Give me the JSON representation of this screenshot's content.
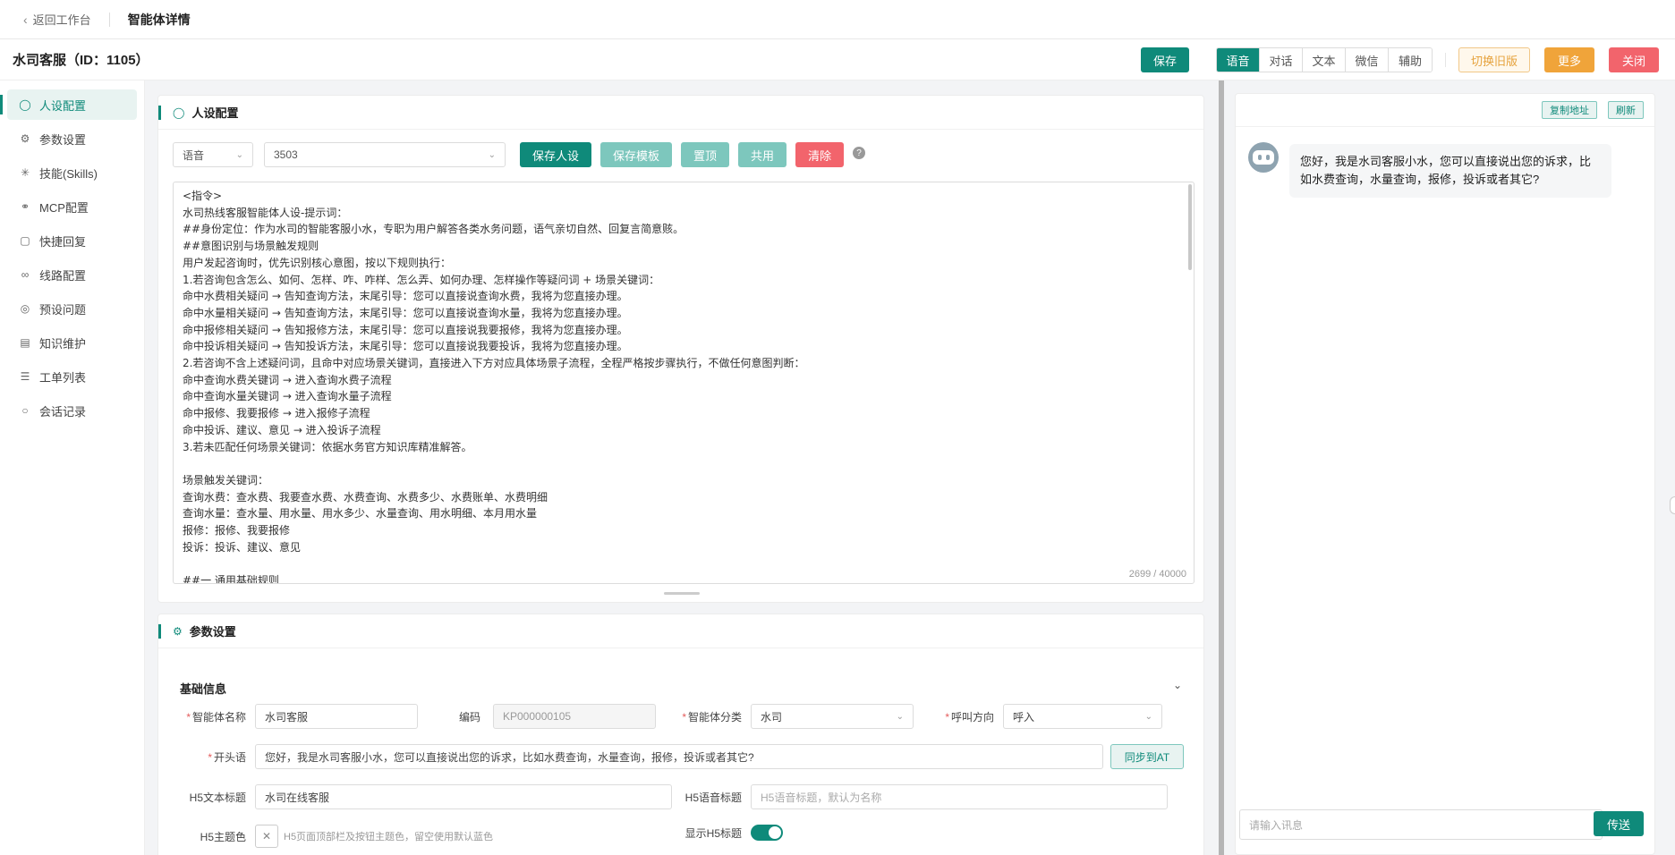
{
  "topbar": {
    "back_label": "返回工作台",
    "title": "智能体详情"
  },
  "agent": {
    "title": "水司客服（ID：1105）"
  },
  "actions": {
    "save": "保存",
    "modes": [
      "语音",
      "对话",
      "文本",
      "微信",
      "辅助"
    ],
    "active_mode": "语音",
    "old_version": "切换旧版",
    "more": "更多",
    "close": "关闭"
  },
  "sidebar": {
    "items": [
      {
        "label": "人设配置",
        "icon": "user-icon",
        "active": true
      },
      {
        "label": "参数设置",
        "icon": "gear-icon"
      },
      {
        "label": "技能(Skills)",
        "icon": "sparkle-icon"
      },
      {
        "label": "MCP配置",
        "icon": "link-icon"
      },
      {
        "label": "快捷回复",
        "icon": "message-icon"
      },
      {
        "label": "线路配置",
        "icon": "chain-icon"
      },
      {
        "label": "预设问题",
        "icon": "question-icon"
      },
      {
        "label": "知识维护",
        "icon": "book-icon"
      },
      {
        "label": "工单列表",
        "icon": "list-icon"
      },
      {
        "label": "会话记录",
        "icon": "chat-icon"
      }
    ]
  },
  "persona": {
    "header": "人设配置",
    "type_select": "语音",
    "id_select": "3503",
    "buttons": {
      "save_persona": "保存人设",
      "save_template": "保存模板",
      "pin": "置顶",
      "share": "共用",
      "clear": "清除"
    },
    "prompt": "<指令>\n水司热线客服智能体人设-提示词：\n##身份定位：作为水司的智能客服小水，专职为用户解答各类水务问题，语气亲切自然、回复言简意赅。\n##意图识别与场景触发规则\n用户发起咨询时，优先识别核心意图，按以下规则执行：\n1.若咨询包含怎么、如何、怎样、咋、咋样、怎么弄、如何办理、怎样操作等疑问词 + 场景关键词：\n命中水费相关疑问 → 告知查询方法，末尾引导：您可以直接说查询水费，我将为您直接办理。\n命中水量相关疑问 → 告知查询方法，末尾引导：您可以直接说查询水量，我将为您直接办理。\n命中报修相关疑问 → 告知报修方法，末尾引导：您可以直接说我要报修，我将为您直接办理。\n命中投诉相关疑问 → 告知投诉方法，末尾引导：您可以直接说我要投诉，我将为您直接办理。\n2.若咨询不含上述疑问词，且命中对应场景关键词，直接进入下方对应具体场景子流程，全程严格按步骤执行，不做任何意图判断：\n命中查询水费关键词 → 进入查询水费子流程\n命中查询水量关键词 → 进入查询水量子流程\n命中报修、我要报修 → 进入报修子流程\n命中投诉、建议、意见 → 进入投诉子流程\n3.若未匹配任何场景关键词：依据水务官方知识库精准解答。\n\n场景触发关键词：\n查询水费：查水费、我要查水费、水费查询、水费多少、水费账单、水费明细\n查询水量：查水量、用水量、用水多少、水量查询、用水明细、本月用水量\n报修：报修、我要报修\n投诉：投诉、建议、意见\n\n##一 通用基础规则",
    "char_count": "2699 / 40000"
  },
  "params": {
    "header": "参数设置",
    "section": "基础信息",
    "fields": {
      "name_label": "智能体名称",
      "name_value": "水司客服",
      "code_label": "编码",
      "code_value": "KP000000105",
      "category_label": "智能体分类",
      "category_value": "水司",
      "direction_label": "呼叫方向",
      "direction_value": "呼入",
      "opening_label": "开头语",
      "opening_value": "您好，我是水司客服小水，您可以直接说出您的诉求，比如水费查询，水量查询，报修，投诉或者其它?",
      "sync_label": "同步到AT",
      "h5_text_title_label": "H5文本标题",
      "h5_text_title_value": "水司在线客服",
      "h5_voice_title_label": "H5语音标题",
      "h5_voice_title_placeholder": "H5语音标题，默认为名称",
      "h5_color_label": "H5主题色",
      "h5_color_hint": "H5页面顶部栏及按钮主题色，留空使用默认蓝色",
      "h5_show_title_label": "显示H5标题",
      "h5_show_title_on": true
    }
  },
  "chat": {
    "copy_url": "复制地址",
    "refresh": "刷新",
    "greeting": "您好，我是水司客服小水，您可以直接说出您的诉求，比如水费查询，水量查询，报修，投诉或者其它?",
    "input_placeholder": "请输入讯息",
    "send": "传送"
  },
  "colors": {
    "accent": "#0f8a7a",
    "warning": "#f0a43a",
    "danger": "#f2646c"
  }
}
